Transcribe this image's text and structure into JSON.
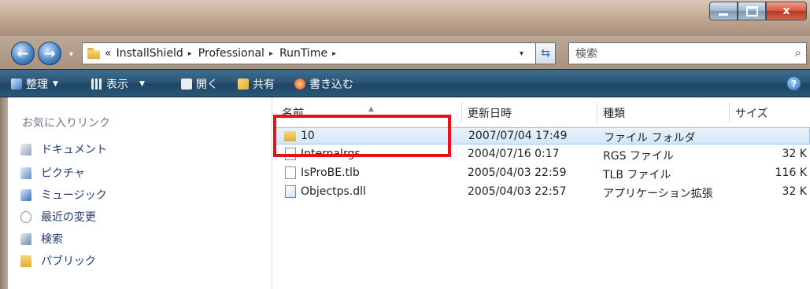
{
  "window": {
    "minimize_icon": "minimize-icon",
    "maximize_icon": "maximize-icon",
    "close_icon": "close-icon",
    "close_glyph": "x"
  },
  "address": {
    "overflow": "«",
    "crumbs": [
      "InstallShield",
      "Professional",
      "RunTime"
    ],
    "separator": "▸",
    "dropdown": "▾",
    "search_placeholder": "検索",
    "search_icon": "⌕",
    "refresh_icon": "⇆"
  },
  "toolbar": {
    "organize": "整理",
    "views": "表示",
    "open": "開く",
    "share": "共有",
    "burn": "書き込む",
    "help": "?"
  },
  "nav": {
    "favorites_title": "お気に入りリンク",
    "items": [
      "ドキュメント",
      "ピクチャ",
      "ミュージック",
      "最近の変更",
      "検索",
      "パブリック"
    ]
  },
  "columns": {
    "name": "名前",
    "modified": "更新日時",
    "type": "種類",
    "size": "サイズ"
  },
  "files": [
    {
      "name": "10",
      "modified": "2007/07/04 17:49",
      "type": "ファイル フォルダ",
      "size": ""
    },
    {
      "name": "Internalrgs",
      "modified": "2004/07/16 0:17",
      "type": "RGS ファイル",
      "size": "32 K"
    },
    {
      "name": "IsProBE.tlb",
      "modified": "2005/04/03 22:59",
      "type": "TLB ファイル",
      "size": "116 K"
    },
    {
      "name": "Objectps.dll",
      "modified": "2005/04/03 22:57",
      "type": "アプリケーション拡張",
      "size": "32 K"
    }
  ],
  "colors": {
    "toolbar": "#2c5676",
    "selection": "#d2e7fa",
    "highlight": "#e8101a"
  }
}
